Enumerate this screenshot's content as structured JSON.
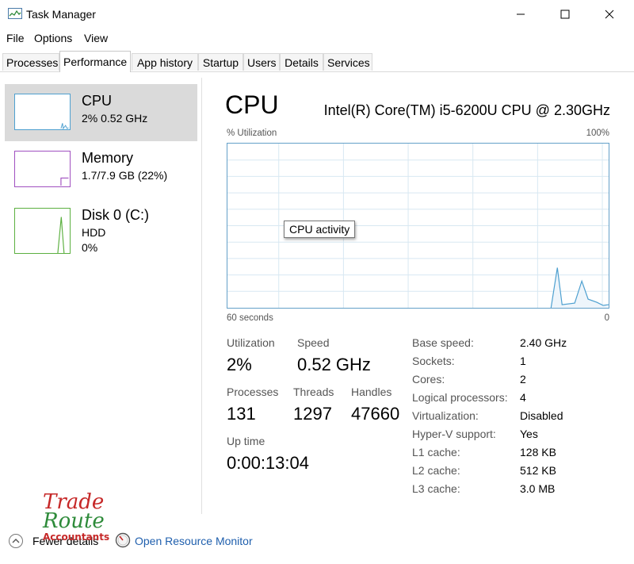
{
  "window": {
    "title": "Task Manager"
  },
  "menu": [
    "File",
    "Options",
    "View"
  ],
  "tabs": [
    "Processes",
    "Performance",
    "App history",
    "Startup",
    "Users",
    "Details",
    "Services"
  ],
  "active_tab": "Performance",
  "resources": [
    {
      "name": "CPU",
      "lines": [
        "2%  0.52 GHz"
      ],
      "color": "#4ea0d0"
    },
    {
      "name": "Memory",
      "lines": [
        "1.7/7.9 GB (22%)"
      ],
      "color": "#a050c0"
    },
    {
      "name": "Disk 0 (C:)",
      "lines": [
        "HDD",
        "0%"
      ],
      "color": "#5cb040"
    }
  ],
  "main": {
    "title": "CPU",
    "model": "Intel(R) Core(TM) i5-6200U CPU @ 2.30GHz",
    "graph_top_left": "% Utilization",
    "graph_top_right": "100%",
    "graph_bottom_left": "60 seconds",
    "graph_bottom_right": "0",
    "tooltip": "CPU activity"
  },
  "stats": {
    "utilization_label": "Utilization",
    "utilization_value": "2%",
    "speed_label": "Speed",
    "speed_value": "0.52 GHz",
    "processes_label": "Processes",
    "processes_value": "131",
    "threads_label": "Threads",
    "threads_value": "1297",
    "handles_label": "Handles",
    "handles_value": "47660",
    "uptime_label": "Up time",
    "uptime_value": "0:00:13:04"
  },
  "specs": [
    {
      "label": "Base speed:",
      "value": "2.40 GHz"
    },
    {
      "label": "Sockets:",
      "value": "1"
    },
    {
      "label": "Cores:",
      "value": "2"
    },
    {
      "label": "Logical processors:",
      "value": "4"
    },
    {
      "label": "Virtualization:",
      "value": "Disabled"
    },
    {
      "label": "Hyper-V support:",
      "value": "Yes"
    },
    {
      "label": "L1 cache:",
      "value": "128 KB"
    },
    {
      "label": "L2 cache:",
      "value": "512 KB"
    },
    {
      "label": "L3 cache:",
      "value": "3.0 MB"
    }
  ],
  "bottom": {
    "fewer_details": "Fewer details",
    "open_resource_monitor": "Open Resource Monitor"
  },
  "watermark": {
    "line1": "Trade",
    "line2": "Route",
    "line3": "Accountants"
  },
  "icons": {
    "app": "task-manager-icon",
    "minimize": "minimize-icon",
    "maximize": "maximize-icon",
    "close": "close-icon",
    "fewer": "chevron-up-circle-icon",
    "resource_monitor": "resource-monitor-icon"
  },
  "colors": {
    "cpu_graph_border": "#64a0c8",
    "link": "#1f5fad",
    "selected_bg": "#dadada"
  }
}
